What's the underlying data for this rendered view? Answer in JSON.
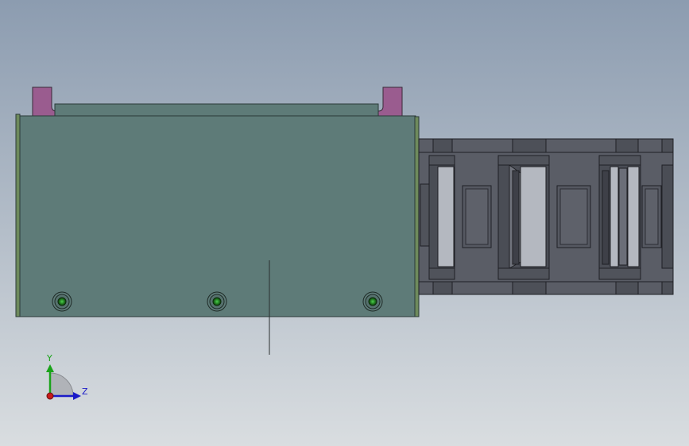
{
  "viewport": {
    "background_top": "#8c9cb0",
    "background_bottom": "#d9dde0"
  },
  "model": {
    "housing_color": "#5e7b78",
    "housing_edge_color": "#6e8a5c",
    "tab_color": "#9a5c8f",
    "screw_color": "#2e8a2e",
    "chain_color": "#5a5d66",
    "chain_dark": "#3e4048",
    "chain_light": "#b4b8c0",
    "chain_window": "#6b6e78"
  },
  "triad": {
    "y_label": "Y",
    "z_label": "Z",
    "y_color": "#1aa31a",
    "z_color": "#1a1ac8",
    "x_color": "#c81a1a"
  }
}
